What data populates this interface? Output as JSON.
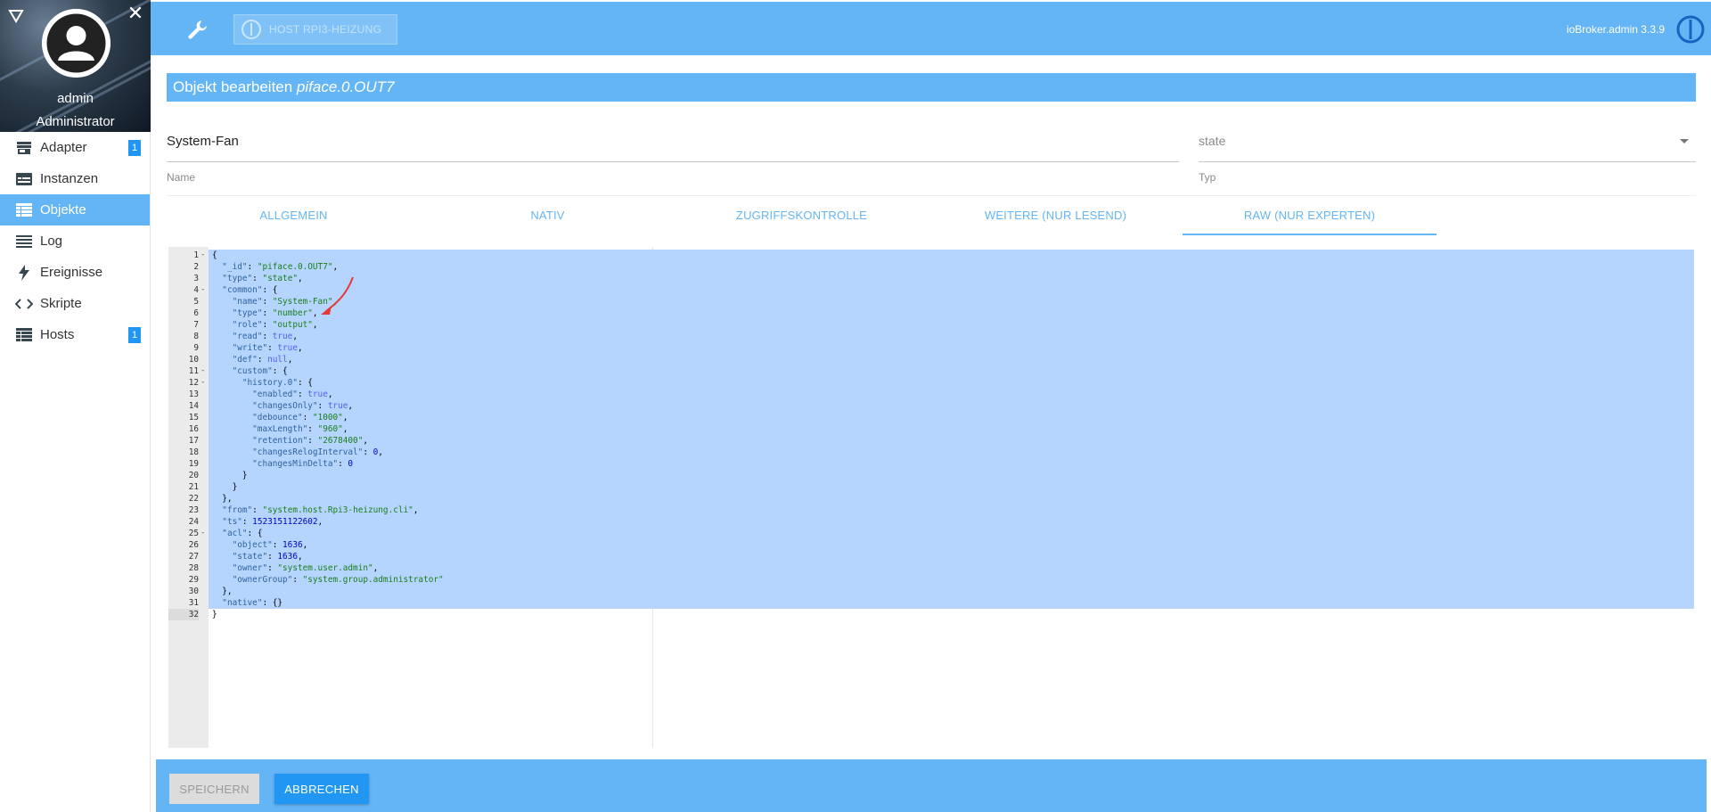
{
  "sidebar": {
    "user": {
      "name": "admin",
      "role": "Administrator"
    },
    "items": [
      {
        "label": "Adapter",
        "icon": "store-icon",
        "badge": "1"
      },
      {
        "label": "Instanzen",
        "icon": "instances-icon",
        "badge": ""
      },
      {
        "label": "Objekte",
        "icon": "objects-icon",
        "badge": "",
        "active": true
      },
      {
        "label": "Log",
        "icon": "log-icon",
        "badge": ""
      },
      {
        "label": "Ereignisse",
        "icon": "events-icon",
        "badge": ""
      },
      {
        "label": "Skripte",
        "icon": "scripts-icon",
        "badge": ""
      },
      {
        "label": "Hosts",
        "icon": "hosts-icon",
        "badge": "1"
      }
    ]
  },
  "topbar": {
    "host_label": "HOST RPI3-HEIZUNG",
    "version": "ioBroker.admin 3.3.9"
  },
  "dialog": {
    "title_prefix": "Objekt bearbeiten ",
    "title_object": "piface.0.OUT7",
    "name_value": "System-Fan",
    "name_label": "Name",
    "type_value": "state",
    "type_label": "Typ",
    "tabs": [
      "ALLGEMEIN",
      "NATIV",
      "ZUGRIFFSKONTROLLE",
      "WEITERE (NUR LESEND)",
      "RAW (NUR EXPERTEN)"
    ],
    "active_tab": 4,
    "save_label": "SPEICHERN",
    "cancel_label": "ABBRECHEN"
  },
  "editor": {
    "code_lines": [
      "{",
      "  \"_id\": \"piface.0.OUT7\",",
      "  \"type\": \"state\",",
      "  \"common\": {",
      "    \"name\": \"System-Fan\",",
      "    \"type\": \"number\",",
      "    \"role\": \"output\",",
      "    \"read\": true,",
      "    \"write\": true,",
      "    \"def\": null,",
      "    \"custom\": {",
      "      \"history.0\": {",
      "        \"enabled\": true,",
      "        \"changesOnly\": true,",
      "        \"debounce\": \"1000\",",
      "        \"maxLength\": \"960\",",
      "        \"retention\": \"2678400\",",
      "        \"changesRelogInterval\": 0,",
      "        \"changesMinDelta\": 0",
      "      }",
      "    }",
      "  },",
      "  \"from\": \"system.host.Rpi3-heizung.cli\",",
      "  \"ts\": 1523151122602,",
      "  \"acl\": {",
      "    \"object\": 1636,",
      "    \"state\": 1636,",
      "    \"owner\": \"system.user.admin\",",
      "    \"ownerGroup\": \"system.group.administrator\"",
      "  },",
      "  \"native\": {}",
      "}"
    ],
    "fold_lines": [
      1,
      4,
      11,
      12,
      25
    ],
    "active_line": 32
  },
  "colors": {
    "primary": "#64b5f6",
    "accent": "#2196f3",
    "selection": "#b5d5ff"
  }
}
